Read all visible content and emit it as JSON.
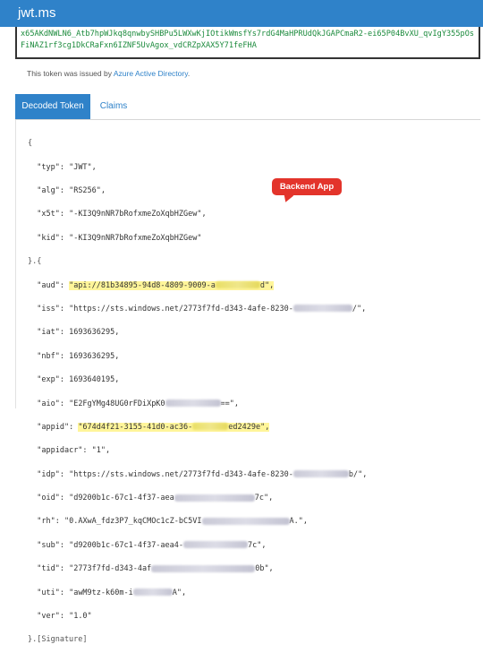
{
  "app": {
    "title": "jwt.ms"
  },
  "token": {
    "line1": "x65AKdNWLN6_Atb7hpWJkq8qnwbySHBPu5LWXwKjIOtikWmsfYs7rdG4MaHPRUdQkJGAPCmaR2-ei65P04BvXU_qvIgY355pOs",
    "line2": "FiNAZ1rf3cg1DkCRaFxn6IZNF5UvAgox_vdCRZpXAX5Y71feFHA"
  },
  "issued": {
    "prefix": "This token was issued by ",
    "issuer": "Azure Active Directory",
    "suffix": "."
  },
  "tabs": {
    "decoded": "Decoded Token",
    "claims": "Claims"
  },
  "callout": {
    "label": "Backend App"
  },
  "decoded": {
    "open_brace": "{",
    "header": {
      "typ": "\"JWT\",",
      "alg": "\"RS256\",",
      "x5t": "\"-KI3Q9nNR7bRofxmeZoXqbHZGew\",",
      "kid": "\"-KI3Q9nNR7bRofxmeZoXqbHZGew\""
    },
    "separator": "}.{",
    "payload": {
      "aud_a": "\"api://81b34895-94d8-4809-9009-a",
      "aud_b": "d\",",
      "iss_a": "\"https://sts.windows.net/2773f7fd-d343-4afe-8230-",
      "iss_b": "/\",",
      "iat": "1693636295,",
      "nbf": "1693636295,",
      "exp": "1693640195,",
      "aio_a": "\"E2FgYMg48UG0rFDiXpK0",
      "aio_b": "==\",",
      "appid_a": "\"674d4f21-3155-41d0-ac36-",
      "appid_b": "ed2429e\",",
      "appidacr": "\"1\",",
      "idp_a": "\"https://sts.windows.net/2773f7fd-d343-4afe-8230-",
      "idp_b": "b/\",",
      "oid_a": "\"d9200b1c-67c1-4f37-aea",
      "oid_b": "7c\",",
      "rh_a": "\"0.AXwA_fdz3P7_kqCMOc1cZ-bC5VI",
      "rh_b": "A.\",",
      "sub_a": "\"d9200b1c-67c1-4f37-aea4-",
      "sub_b": "7c\",",
      "tid_a": "\"2773f7fd-d343-4af",
      "tid_b": "0b\",",
      "uti_a": "\"awM9tz-k60m-i",
      "uti_b": "A\",",
      "ver": "\"1.0\""
    },
    "close_sig": "}.[Signature]"
  }
}
